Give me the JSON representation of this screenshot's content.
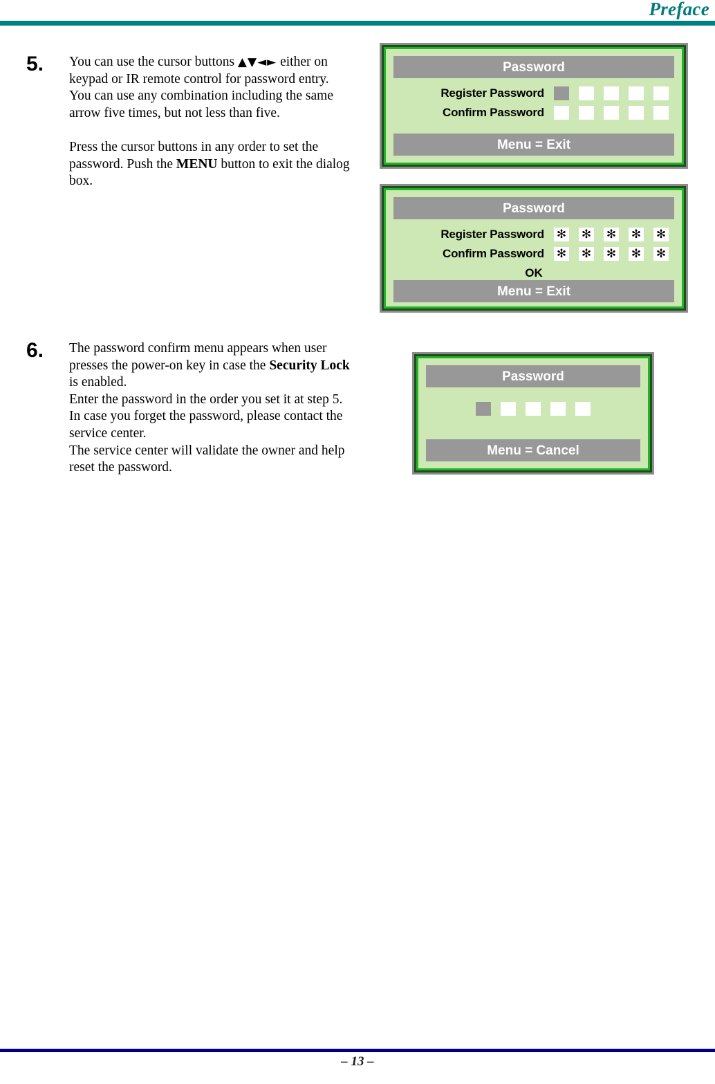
{
  "header": {
    "title": "Preface",
    "rule_color": "#00807e"
  },
  "footer": {
    "page_number": "– 13 –",
    "rule_color": "#000080"
  },
  "steps": [
    {
      "number": "5.",
      "paragraph1_pre": "You can use the cursor buttons ",
      "arrows": "▲▼◄►",
      "paragraph1_post": " either on keypad or IR remote control for password entry. You can use any combination including the same arrow five times, but not less than five.",
      "paragraph2_pre": "Press the cursor buttons in any order to set the password. Push the ",
      "paragraph2_bold": "MENU",
      "paragraph2_post": " button to exit the dialog box."
    },
    {
      "number": "6.",
      "line1": "The password confirm menu appears when user presses the power-on key in case the ",
      "bold_term": "Security Lock",
      "line2": " is enabled.",
      "line3": "Enter the password in the order you set it at step 5. In case you forget the password, please contact the service center.",
      "line4": "The service center will validate the owner and help reset the password."
    }
  ],
  "osd_dialogs": [
    {
      "id": "register",
      "title": "Password",
      "footer": "Menu = Exit",
      "rows": [
        {
          "label": "Register Password",
          "boxes": [
            "selected",
            "empty",
            "empty",
            "empty",
            "empty"
          ]
        },
        {
          "label": "Confirm Password",
          "boxes": [
            "empty",
            "empty",
            "empty",
            "empty",
            "empty"
          ]
        }
      ],
      "ok_label": ""
    },
    {
      "id": "confirmed",
      "title": "Password",
      "footer": "Menu = Exit",
      "rows": [
        {
          "label": "Register Password",
          "boxes": [
            "asterisk",
            "asterisk",
            "asterisk",
            "asterisk",
            "asterisk"
          ]
        },
        {
          "label": "Confirm Password",
          "boxes": [
            "asterisk",
            "asterisk",
            "asterisk",
            "asterisk",
            "asterisk"
          ]
        }
      ],
      "ok_label": "OK"
    },
    {
      "id": "powerlock",
      "title": "Password",
      "footer": "Menu = Cancel",
      "single_row_boxes": [
        "selected",
        "empty",
        "empty",
        "empty",
        "empty"
      ]
    }
  ],
  "glyphs": {
    "asterisk": "✻",
    "arrow_up": "▲",
    "arrow_down": "▼",
    "arrow_left": "◄",
    "arrow_right": "►"
  },
  "colors": {
    "header_teal": "#007b7b",
    "header_rule": "#00807e",
    "footer_rule": "#000080",
    "osd_background": "#cde8b4",
    "osd_bar": "#989898",
    "osd_border_dark_green": "#1e4d1e",
    "osd_border_bright_green": "#22b422",
    "osd_outer_frame": "#8c8c8c"
  }
}
